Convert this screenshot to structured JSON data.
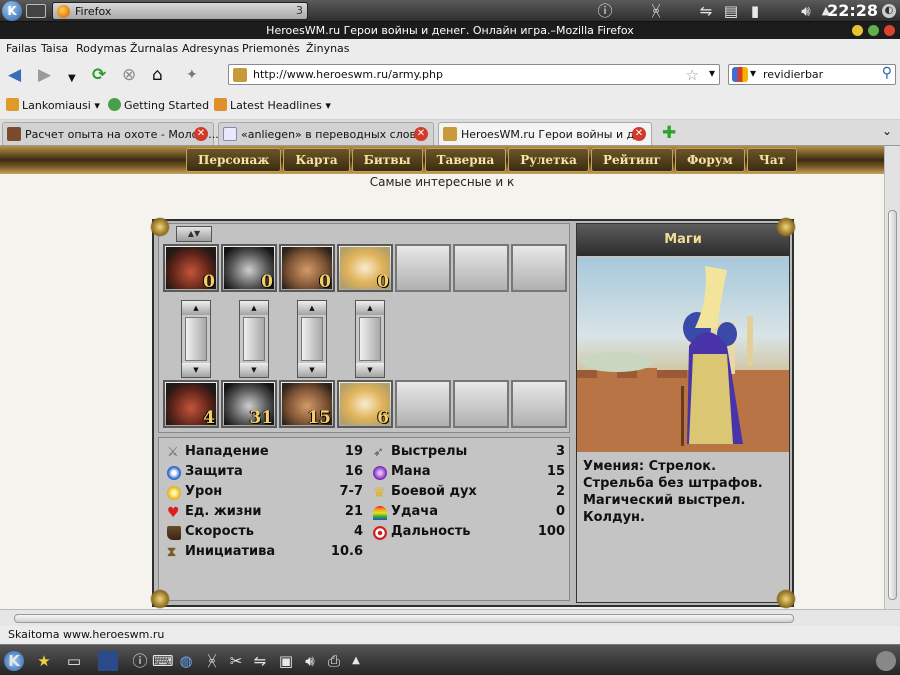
{
  "panel_top": {
    "window_entry": "Firefox",
    "desktop_num": "3",
    "clock": "22:28"
  },
  "window": {
    "title": "HeroesWM.ru Герои войны и денег. Онлайн игра.–Mozilla Firefox"
  },
  "menu": [
    "Failas",
    "Taisa",
    "Rodymas",
    "Žurnalas",
    "Adresynas",
    "Priemonės",
    "Žinynas"
  ],
  "nav": {
    "url": "http://www.heroeswm.ru/army.php",
    "search": "revidierbar"
  },
  "bookmarks": [
    "Lankomiausi",
    "Getting Started",
    "Latest Headlines"
  ],
  "tabs": [
    "Расчет опыта на охоте - Молот ...",
    "«anliegen» в переводных слов...",
    "HeroesWM.ru Герои войны и д..."
  ],
  "game_nav": [
    "Персонаж",
    "Карта",
    "Битвы",
    "Таверна",
    "Рулетка",
    "Рейтинг",
    "Форум",
    "Чат"
  ],
  "subtext": "Самые интересные и к",
  "army": {
    "top_counts": [
      "0",
      "0",
      "0",
      "0"
    ],
    "bottom_counts": [
      "4",
      "31",
      "15",
      "6"
    ]
  },
  "unit": {
    "name": "Маги",
    "stats_left": [
      {
        "label": "Нападение",
        "value": "19",
        "icon": "swords-icon"
      },
      {
        "label": "Защита",
        "value": "16",
        "icon": "shield-icon"
      },
      {
        "label": "Урон",
        "value": "7-7",
        "icon": "damage-icon"
      },
      {
        "label": "Ед. жизни",
        "value": "21",
        "icon": "heart-icon"
      },
      {
        "label": "Скорость",
        "value": "4",
        "icon": "boot-icon"
      },
      {
        "label": "Инициатива",
        "value": "10.6",
        "icon": "hourglass-icon"
      }
    ],
    "stats_right": [
      {
        "label": "Выстрелы",
        "value": "3",
        "icon": "arrow-icon"
      },
      {
        "label": "Мана",
        "value": "15",
        "icon": "mana-icon"
      },
      {
        "label": "Боевой дух",
        "value": "2",
        "icon": "morale-icon"
      },
      {
        "label": "Удача",
        "value": "0",
        "icon": "rainbow-icon"
      },
      {
        "label": "Дальность",
        "value": "100",
        "icon": "target-icon"
      }
    ],
    "skills": "Умения: Стрелок. Стрельба без штрафов. Магический выстрел. Колдун."
  },
  "status": "Skaitoma www.heroeswm.ru"
}
